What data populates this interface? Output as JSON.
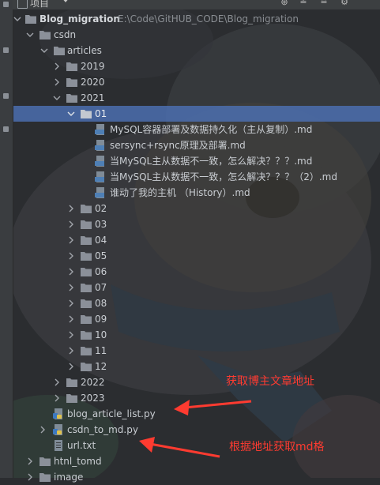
{
  "header": {
    "title": "项目",
    "actions": [
      "add-icon",
      "collapse-all-icon",
      "expand-all-icon",
      "settings-icon"
    ]
  },
  "project": {
    "name": "Blog_migration",
    "path": "E:\\Code\\GitHUB_CODE\\Blog_migration"
  },
  "tree": {
    "csdn": "csdn",
    "articles": "articles",
    "y2019": "2019",
    "y2020": "2020",
    "y2021": "2021",
    "m01": "01",
    "files": [
      "MySQL容器部署及数据持久化（主从复制）.md",
      "sersync+rsync原理及部署.md",
      "当MySQL主从数据不一致，怎么解决？？？.md",
      "当MySQL主从数据不一致，怎么解决？？？（2）.md",
      "谁动了我的主机 （History）.md"
    ],
    "months": [
      "02",
      "03",
      "04",
      "05",
      "06",
      "07",
      "08",
      "09",
      "10",
      "11",
      "12"
    ],
    "y2022": "2022",
    "y2023": "2023",
    "blog_article_list": "blog_article_list.py",
    "csdn_to_md": "csdn_to_md.py",
    "url_txt": "url.txt",
    "htnl_tomd": "htnl_tomd",
    "image": "image"
  },
  "annotations": {
    "first": "获取博主文章地址",
    "second": "根据地址获取md格"
  },
  "colors": {
    "selection": "#4b6eaf",
    "folder": "#8b9099",
    "annotation": "#ff3b30"
  }
}
